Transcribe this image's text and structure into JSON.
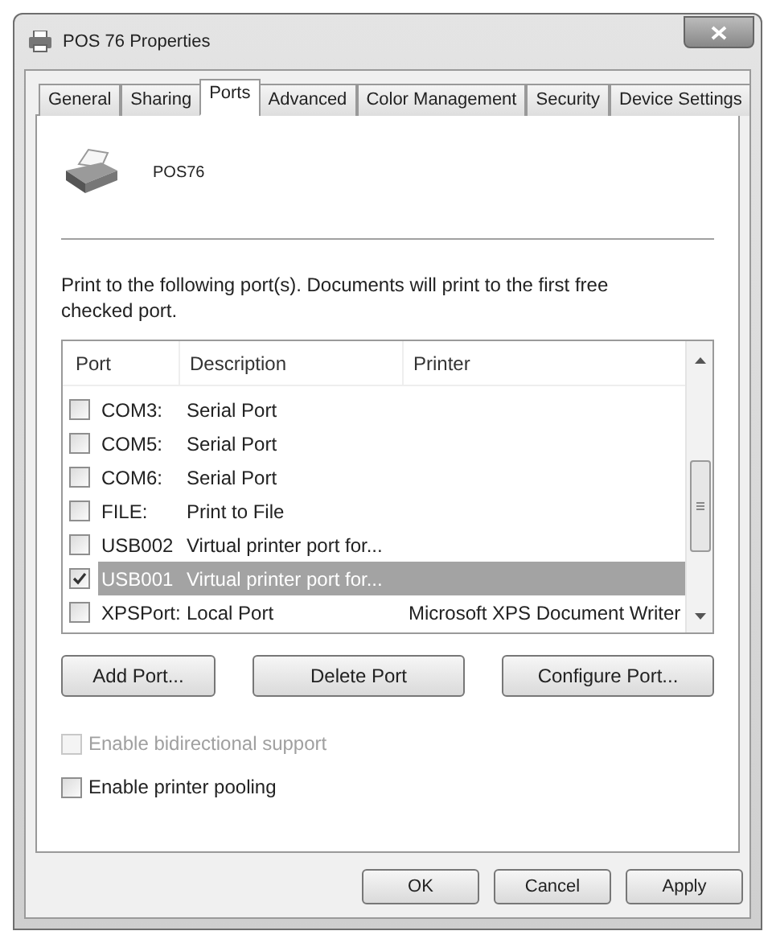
{
  "window": {
    "title": "POS 76 Properties"
  },
  "tabs": [
    {
      "label": "General",
      "selected": false
    },
    {
      "label": "Sharing",
      "selected": false
    },
    {
      "label": "Ports",
      "selected": true
    },
    {
      "label": "Advanced",
      "selected": false
    },
    {
      "label": "Color Management",
      "selected": false
    },
    {
      "label": "Security",
      "selected": false
    },
    {
      "label": "Device Settings",
      "selected": false
    }
  ],
  "printer_name": "POS76",
  "instructions": "Print to the following port(s). Documents will print to the first free checked port.",
  "port_list": {
    "columns": [
      "Port",
      "Description",
      "Printer"
    ],
    "rows": [
      {
        "port": "COM3:",
        "description": "Serial Port",
        "checked": false,
        "selected": false
      },
      {
        "port": "COM5:",
        "description": "Serial Port",
        "checked": false,
        "selected": false
      },
      {
        "port": "COM6:",
        "description": "Serial Port",
        "checked": false,
        "selected": false
      },
      {
        "port": "FILE:",
        "description": "Print to File",
        "checked": false,
        "selected": false
      },
      {
        "port": "USB002",
        "description": "Virtual printer port for...",
        "checked": false,
        "selected": false
      },
      {
        "port": "USB001",
        "description": "Virtual printer port for...",
        "checked": true,
        "selected": true
      },
      {
        "port": "XPSPort:",
        "description": "Local Port",
        "printer": "Microsoft XPS Document Writer",
        "checked": false,
        "selected": false
      }
    ]
  },
  "port_buttons": [
    "Add Port...",
    "Delete Port",
    "Configure Port..."
  ],
  "options": [
    {
      "label": "Enable bidirectional support",
      "checked": false,
      "disabled": true
    },
    {
      "label": "Enable printer pooling",
      "checked": false,
      "disabled": false
    }
  ],
  "dialog_buttons": [
    {
      "label": "OK",
      "disabled": false
    },
    {
      "label": "Cancel",
      "disabled": false
    },
    {
      "label": "Apply",
      "disabled": false
    }
  ]
}
